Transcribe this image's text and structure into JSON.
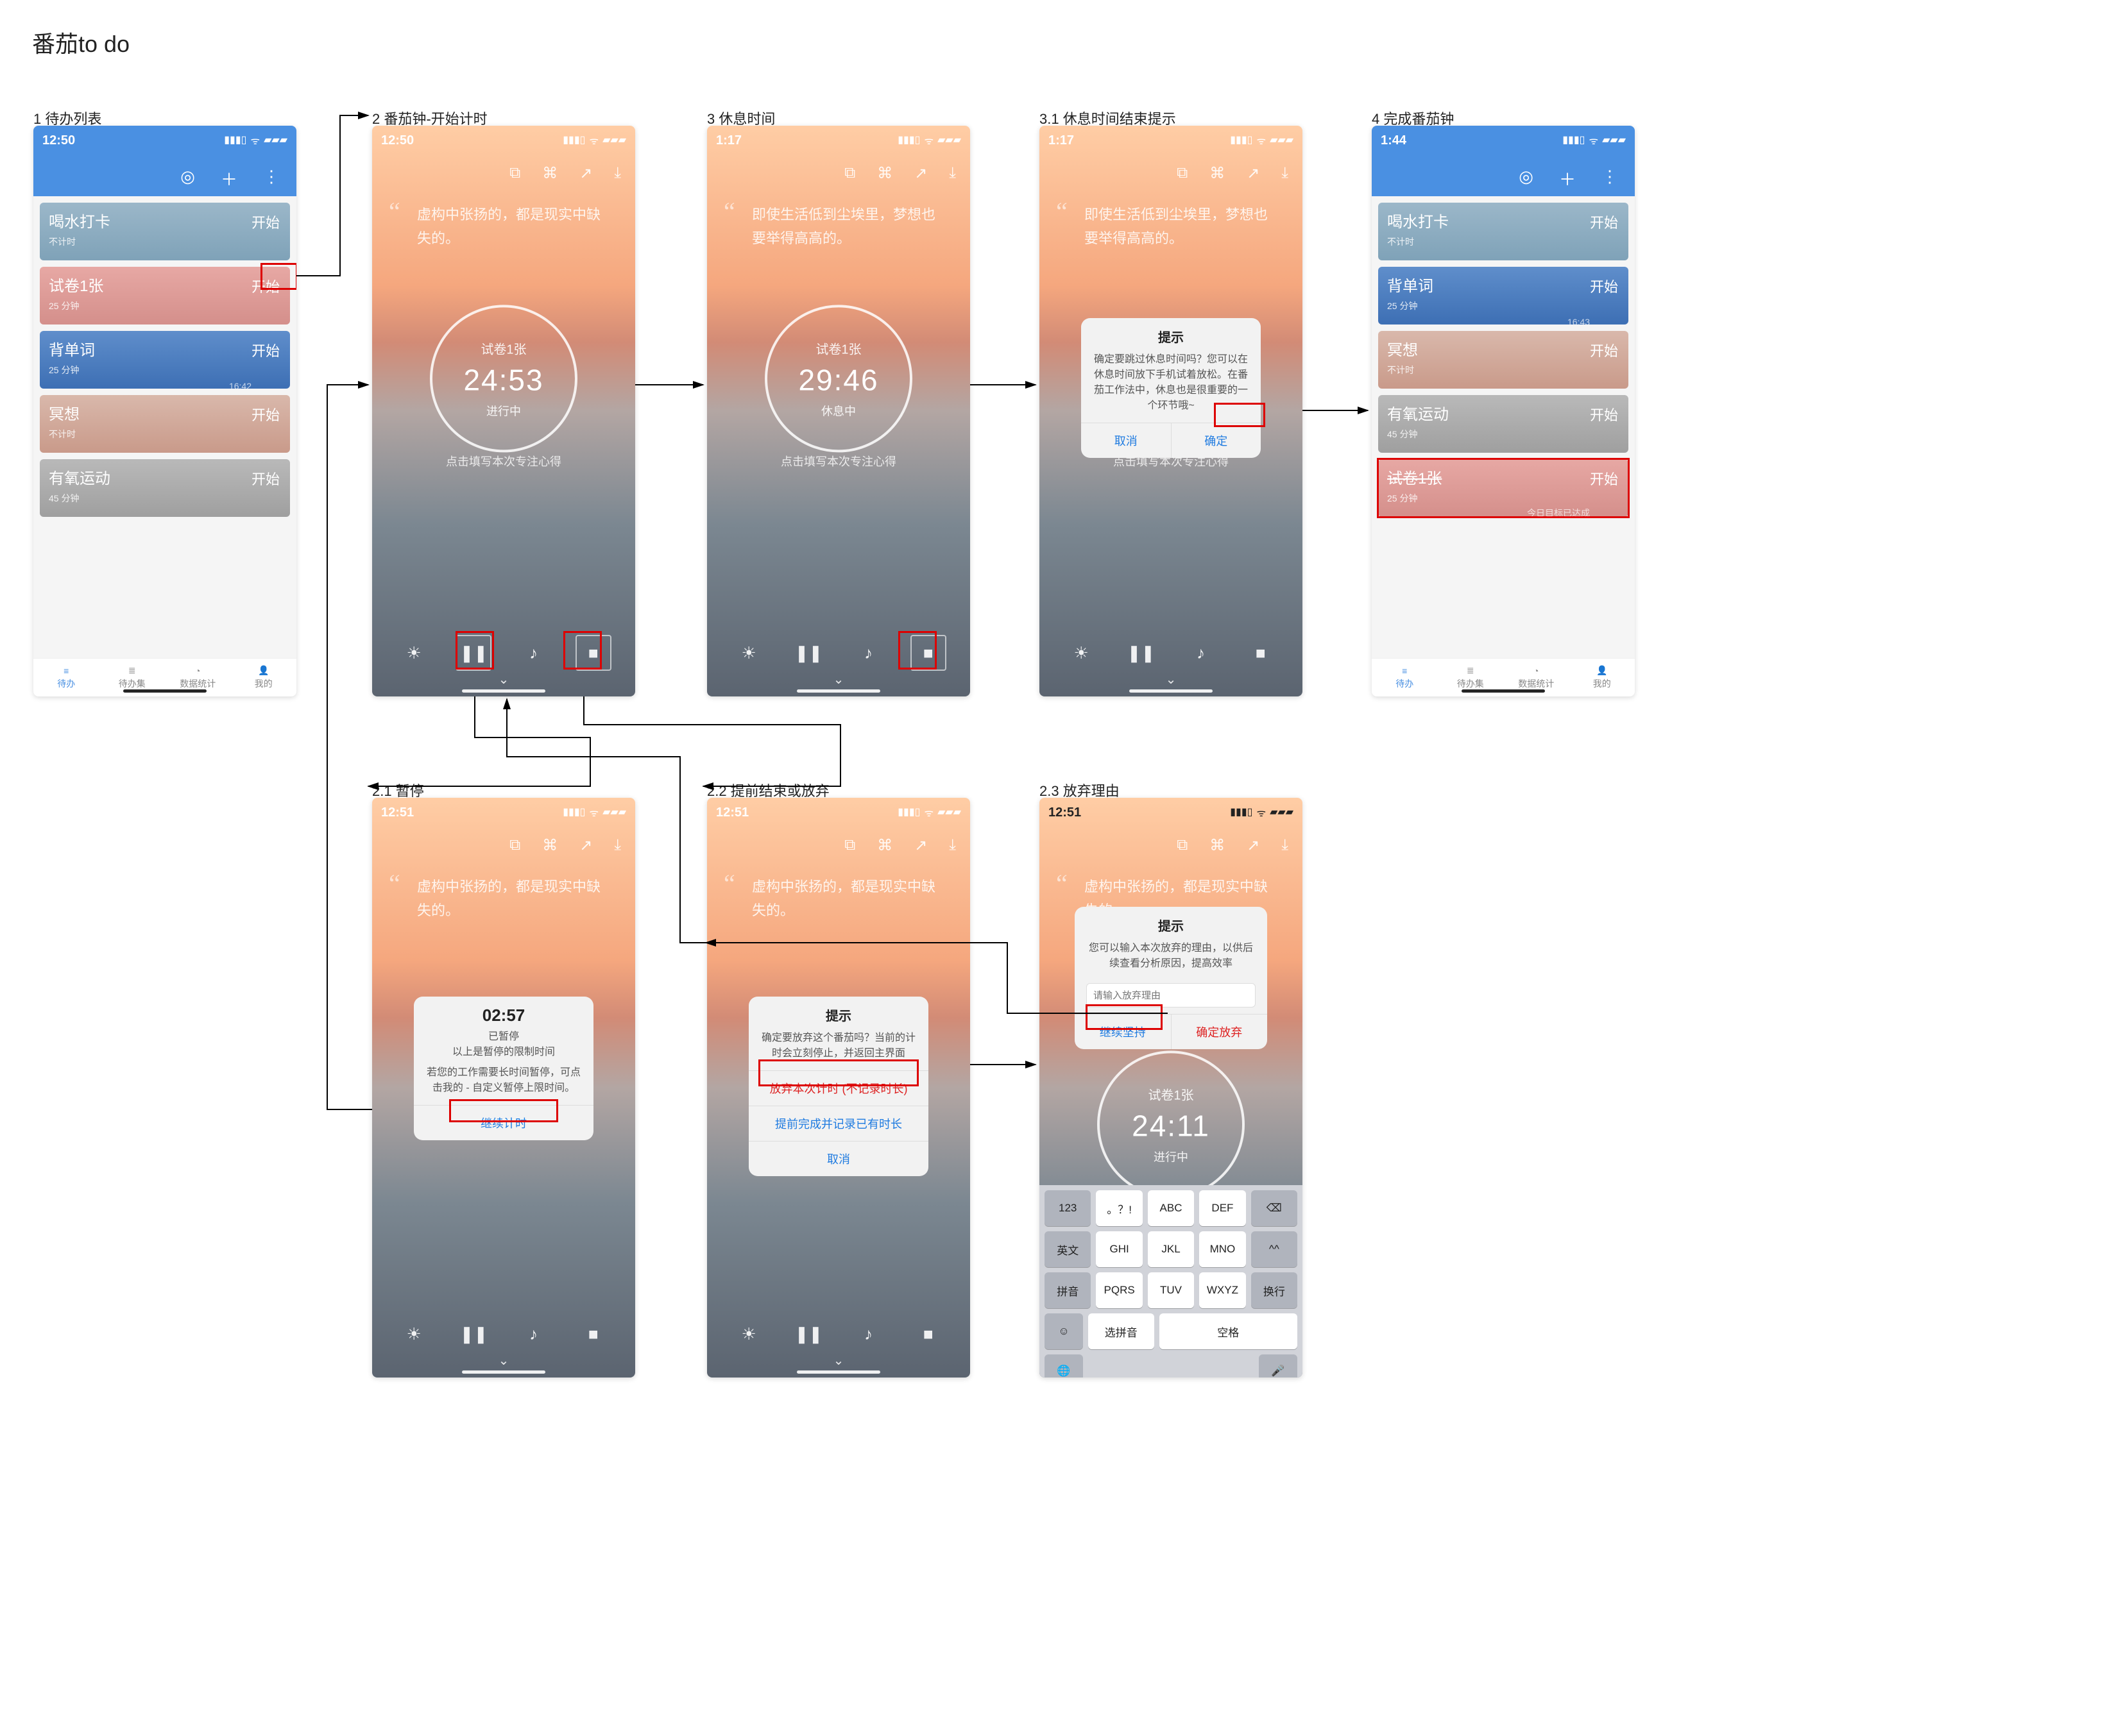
{
  "page_title": "番茄to do",
  "labels": {
    "s1": "1 待办列表",
    "s2": "2 番茄钟-开始计时",
    "s3": "3 休息时间",
    "s31": "3.1 休息时间结束提示",
    "s4": "4 完成番茄钟",
    "s21": "2.1 暂停",
    "s22": "2.2 提前结束或放弃",
    "s23": "2.3 放弃理由"
  },
  "status_icons": {
    "signal": "▮▮▮▯",
    "wifi": "ᯤ",
    "battery": "▰▰▰"
  },
  "tabs": [
    "待办",
    "待办集",
    "数据统计",
    "我的"
  ],
  "tab_icons": [
    "≡",
    "≣",
    "◔",
    "👤"
  ],
  "header_icons": {
    "pin": "◎",
    "plus": "＋",
    "more": "⋮"
  },
  "timer_icons": {
    "i1": "⧉",
    "i2": "⌘",
    "i3": "↗",
    "i4": "⤓",
    "sun": "☀",
    "pause": "❚❚",
    "music": "♪",
    "stop": "■",
    "chev": "⌄"
  },
  "start_label": "开始",
  "s1": {
    "time": "12:50",
    "cards": [
      {
        "title": "喝水打卡",
        "sub": "不计时",
        "style": "c-sky"
      },
      {
        "title": "试卷1张",
        "sub": "25 分钟",
        "style": "c-pink"
      },
      {
        "title": "背单词",
        "sub": "25 分钟",
        "style": "c-blue",
        "deco": "16:42"
      },
      {
        "title": "冥想",
        "sub": "不计时",
        "style": "c-sunset"
      },
      {
        "title": "有氧运动",
        "sub": "45 分钟",
        "style": "c-grey"
      }
    ]
  },
  "s4": {
    "time": "1:44",
    "cards": [
      {
        "title": "喝水打卡",
        "sub": "不计时",
        "style": "c-sky"
      },
      {
        "title": "背单词",
        "sub": "25 分钟",
        "style": "c-blue",
        "deco": "16:43"
      },
      {
        "title": "冥想",
        "sub": "不计时",
        "style": "c-sunset"
      },
      {
        "title": "有氧运动",
        "sub": "45 分钟",
        "style": "c-grey"
      },
      {
        "title": "试卷1张",
        "sub": "25 分钟",
        "style": "c-pink",
        "strike": true,
        "deco": "今日目标已达成"
      }
    ]
  },
  "s2": {
    "time": "12:50",
    "quote": "虚构中张扬的，都是现实中缺失的。",
    "task": "试卷1张",
    "timer": "24:53",
    "state": "进行中",
    "note": "点击填写本次专注心得"
  },
  "s3": {
    "time": "1:17",
    "quote": "即使生活低到尘埃里，梦想也要举得高高的。",
    "task": "试卷1张",
    "timer": "29:46",
    "state": "休息中",
    "note": "点击填写本次专注心得"
  },
  "s31": {
    "time": "1:17",
    "quote": "即使生活低到尘埃里，梦想也要举得高高的。",
    "note": "点击填写本次专注心得",
    "modal": {
      "title": "提示",
      "body": "确定要跳过休息时间吗？您可以在休息时间放下手机试着放松。在番茄工作法中，休息也是很重要的一个环节哦~",
      "cancel": "取消",
      "ok": "确定"
    }
  },
  "s21": {
    "time": "12:51",
    "quote": "虚构中张扬的，都是现实中缺失的。",
    "modal": {
      "t": "02:57",
      "l1": "已暂停",
      "l2": "以上是暂停的限制时间",
      "l3": "若您的工作需要长时间暂停，可点击我的 - 自定义暂停上限时间。",
      "btn": "继续计时"
    }
  },
  "s22": {
    "time": "12:51",
    "quote": "虚构中张扬的，都是现实中缺失的。",
    "modal": {
      "title": "提示",
      "body": "确定要放弃这个番茄吗？当前的计时会立刻停止，并返回主界面",
      "r1": "放弃本次计时 (不记录时长)",
      "r2": "提前完成并记录已有时长",
      "r3": "取消"
    }
  },
  "s23": {
    "time": "12:51",
    "quote": "虚构中张扬的，都是现实中缺失的。",
    "task": "试卷1张",
    "timer": "24:11",
    "state": "进行中",
    "modal": {
      "title": "提示",
      "body": "您可以输入本次放弃的理由，以供后续查看分析原因，提高效率",
      "ph": "请输入放弃理由",
      "left": "继续坚持",
      "right": "确定放弃"
    },
    "kbd": {
      "r1": [
        "123",
        "。？!",
        "ABC",
        "DEF",
        "⌫"
      ],
      "r2": [
        "英文",
        "GHI",
        "JKL",
        "MNO",
        "^^"
      ],
      "r3": [
        "拼音",
        "PQRS",
        "TUV",
        "WXYZ",
        "换行"
      ],
      "r4": [
        "☺",
        "选拼音",
        "空格"
      ],
      "globe": "🌐",
      "mic": "🎤"
    }
  }
}
